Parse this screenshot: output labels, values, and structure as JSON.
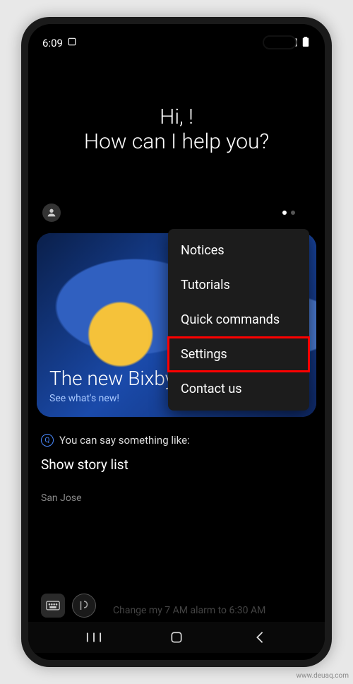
{
  "status": {
    "time": "6:09",
    "wifi": true,
    "signal": true,
    "battery": true
  },
  "greeting": {
    "line1": "Hi,  !",
    "line2": "How can I help you?"
  },
  "card": {
    "title": "The new Bixby",
    "subtitle": "See what's new!"
  },
  "menu": {
    "items": [
      "Notices",
      "Tutorials",
      "Quick commands",
      "Settings",
      "Contact us"
    ],
    "highlighted_index": 3
  },
  "suggestion": {
    "prefix": "Q",
    "text": "You can say something like:"
  },
  "chip": "Show story list",
  "location": "San Jose",
  "faint": "Change my 7 AM alarm to 6:30 AM",
  "watermark": "www.deuaq.com"
}
